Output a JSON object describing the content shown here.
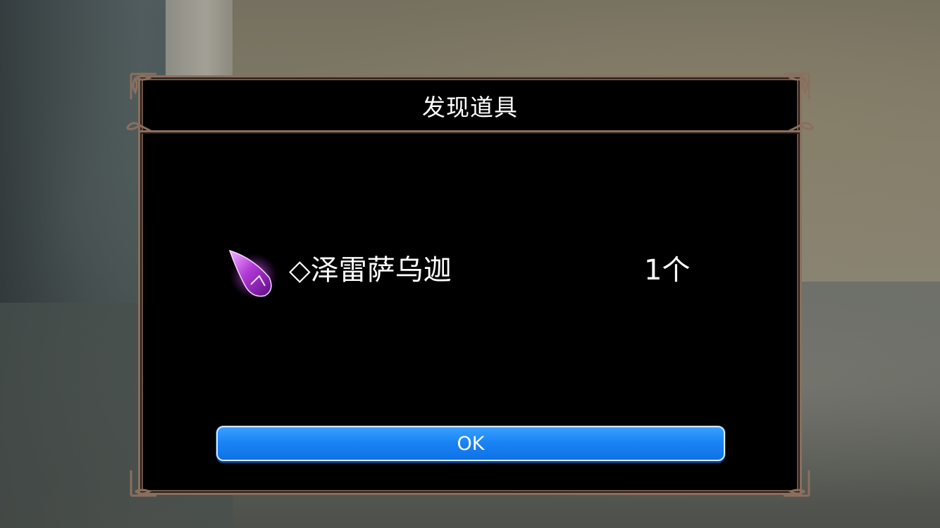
{
  "dialog": {
    "title": "发现道具",
    "item": {
      "name": "◇泽雷萨乌迦",
      "quantity": "1个",
      "icon": "purple-crystal-icon"
    },
    "ok_label": "OK"
  },
  "colors": {
    "frame": "#8a6f5e",
    "button": "#1a84f5",
    "crystal": "#b13ad6"
  }
}
